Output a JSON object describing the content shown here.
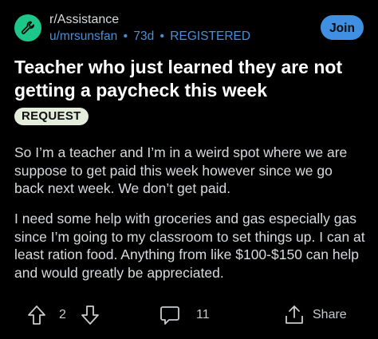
{
  "header": {
    "subreddit": "r/Assistance",
    "author": "u/mrsunsfan",
    "age": "73d",
    "separator": "•",
    "status": "REGISTERED",
    "join_label": "Join"
  },
  "post": {
    "title": "Teacher who just learned they are not getting a paycheck this week",
    "flair": "REQUEST",
    "paragraphs": [
      "So I’m a teacher and I’m in a weird spot where we are suppose to get paid this week however since we go back next week. We don’t get paid.",
      "I need some help with groceries and gas especially gas since I’m going to my classroom to set things up. I can at least ration food. Anything from like $100-$150 can help and would greatly be appreciated."
    ]
  },
  "actions": {
    "votes": "2",
    "comments": "11",
    "share_label": "Share"
  },
  "colors": {
    "background": "#000000",
    "avatar": "#1dc78a",
    "link_blue": "#4a8fd6",
    "join_button": "#3f8fe2",
    "flair_bg": "#e4ecdc"
  },
  "icons": [
    "wrench-icon",
    "upvote-icon",
    "downvote-icon",
    "comment-icon",
    "share-icon"
  ]
}
